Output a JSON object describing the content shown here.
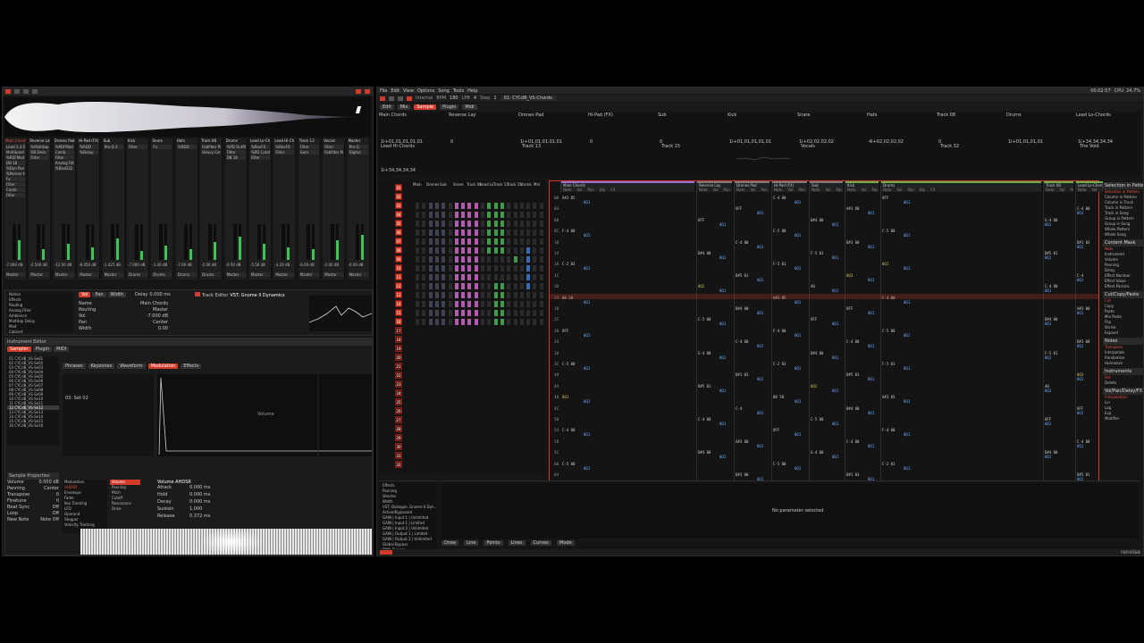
{
  "app": {
    "menu": [
      "File",
      "Edit",
      "View",
      "Options",
      "Song",
      "Tools",
      "Help"
    ],
    "transport": {
      "sync": "Internal",
      "bpm_label": "BPM",
      "bpm": "180",
      "lpb_label": "LPB",
      "lpb": "4",
      "pattern_label": "Ptn",
      "edit_step_label": "Step",
      "edit_step": "1",
      "instrument_select": "01: CYCdB_VS-Chords"
    },
    "status": {
      "cpu": "CPU: 24.7%",
      "time": "00:02:57",
      "brand": "renoise"
    },
    "right_tabs": [
      "Edit",
      "Mix",
      "Sample",
      "Plugin",
      "Midi"
    ],
    "colors": {
      "accent": "#d23a2a",
      "bg": "#161616",
      "note": "#cccccc",
      "volume": "#6ab0ff",
      "effect": "#d8c060",
      "meter": "#3ec35a"
    }
  },
  "automation": {
    "tracks": [
      "Main Chords",
      "Reverse Lay",
      "Drones Pad",
      "Hi-Pad (FX)",
      "Sub",
      "Kick",
      "Snare",
      "Hats",
      "Track 08",
      "Drums",
      "Lead Lo-Chords"
    ],
    "rows": [
      {
        "left": "1l+01,01,01,01,01",
        "right": "Lead Hi-Chords"
      },
      {
        "left": "1l+34,34,34,34",
        "right": ""
      }
    ],
    "cells_row1": [
      "0",
      "1l+01,01,01,01,01",
      "0",
      "0",
      "1l+01,01,01,01,01",
      "1l+02,02,02,02",
      "4l+02,02,02,02",
      "0",
      "1l+01,01,01,01",
      "1l+34,34,34,34"
    ],
    "cells_row1_sub": [
      "Track 13",
      "Track 15",
      "Vocals",
      "Track 32",
      "The Void"
    ]
  },
  "matrix": {
    "tracks": [
      "Main",
      "Drones",
      "Sub",
      "Snare",
      "Track 08",
      "Lead Lo",
      "Track 13",
      "Track 15",
      "Vocals",
      "Mst"
    ]
  },
  "pattern_editor": {
    "track_headers": [
      {
        "name": "Main Chords",
        "color": "#9b6fd8"
      },
      {
        "name": "Reverse Lay",
        "color": "#7a7a7a"
      },
      {
        "name": "Drones Pad",
        "color": "#7a7a7a"
      },
      {
        "name": "Hi-Pad (FX)",
        "color": "#7a7a7a"
      },
      {
        "name": "Sub",
        "color": "#7a7a7a"
      },
      {
        "name": "Kick",
        "color": "#6ab04a"
      },
      {
        "name": "Drums",
        "color": "#6ab04a"
      },
      {
        "name": "Track 08",
        "color": "#6ab04a"
      },
      {
        "name": "Lead Lo-Chords",
        "color": "#6ab04a"
      }
    ],
    "sub_columns": [
      "Note",
      "Vol",
      "Pan",
      "Dly",
      "FX"
    ],
    "row_numbers": [
      "00",
      "04",
      "08",
      "0C",
      "10",
      "14",
      "18",
      "1C",
      "20",
      "24",
      "28",
      "2C",
      "30",
      "34",
      "38",
      "3C",
      "40",
      "44",
      "48",
      "4C",
      "50",
      "54",
      "58",
      "5C",
      "60",
      "64",
      "68",
      "6C",
      "70",
      "74",
      "78",
      "7C"
    ],
    "notes": [
      "A#3 05",
      "C-4 00",
      "D#4 00",
      "C-4 00",
      "C-5 00",
      "OFF",
      "OFF",
      "OFF",
      "A#3 00",
      "F-4 00",
      "D#4 00",
      "C-4 00",
      "C-5 00",
      "G-4 00",
      "C-4 00",
      "C-5 00",
      "D#4 00",
      "D#3 00",
      "C-2 03",
      "F-5 01",
      "D#1 03",
      "F-5 01",
      "D#5 01",
      "D#5 01",
      "0Q1",
      "0Q2",
      "0Q3",
      "08 50",
      "40",
      "C-4"
    ]
  },
  "right_sidebar": {
    "sections": [
      {
        "title": "Selection in Pattern",
        "items": [
          "Selection in Pattern",
          "Column in Pattern",
          "Column in Track",
          "Track in Pattern",
          "Track in Song",
          "Group in Pattern",
          "Group in Song",
          "Whole Pattern",
          "Whole Song"
        ]
      },
      {
        "title": "Content Mask",
        "items": [
          "Note",
          "Instrument",
          "Volume",
          "Panning",
          "Delay",
          "Effect Number",
          "Effect Value",
          "Effect Params"
        ]
      },
      {
        "title": "Cut/Copy/Paste",
        "items": [
          "Cut",
          "Copy",
          "Paste",
          "Mix Paste",
          "Flip",
          "Shrink",
          "Expand"
        ]
      },
      {
        "title": "Notes",
        "items": [
          "Transpose",
          "Interpolate",
          "Randomize",
          "Humanize"
        ]
      },
      {
        "title": "Instruments",
        "items": [
          "Set",
          "Delete"
        ]
      },
      {
        "title": "Vol/Pan/Delay/FX",
        "items": [
          "Interpolation",
          "Lin",
          "Log",
          "Exp",
          "Modifier"
        ]
      }
    ]
  },
  "bottom_panel": {
    "tree_items": [
      "Effects",
      "Panning",
      "Volume",
      "Width",
      "VST: Dialogue, Gnome II Dyn...",
      "Active/Bypassed",
      "GAIN | Input 1 | Unlimited",
      "GAIN | Input 1 | Limited",
      "GAIN | Input 2 | Unlimited",
      "GAIN | Output 1 | Limited",
      "GAIN | Output 2 | Unlimited",
      "Global Bypass",
      "DYN: Bypass",
      "DYN: Sidechain"
    ],
    "no_param": "No parameter selected",
    "toolbar": [
      "Draw",
      "Line",
      "Points",
      "Lines",
      "Curves",
      "Mode"
    ]
  },
  "mixer": {
    "strips": [
      {
        "name": "Main Chords",
        "fx": [
          "Lead 1.3 Dy",
          "Multiband",
          "%PDFMod",
          "DB 18",
          "%Dyn Pan",
          "%Panner Hi",
          "Fx",
          "Filter",
          "Comb",
          "Filter"
        ],
        "db": "-7.000 dB",
        "out": "Master"
      },
      {
        "name": "Reverse Lay",
        "fx": [
          "%Multitap",
          "DB Deck",
          "Filter"
        ],
        "db": "-2.500 dB",
        "out": "Master"
      },
      {
        "name": "Drones Pad",
        "fx": [
          "%PDFMod",
          "Comb",
          "Filter",
          "Analog Filter",
          "%RevD32"
        ],
        "db": "-12.50 dB",
        "out": "Master"
      },
      {
        "name": "Hi-Pad (FX)",
        "fx": [
          "%RDD",
          "%Delay"
        ],
        "db": "-6.050 dB",
        "out": "Master"
      },
      {
        "name": "Sub",
        "fx": [
          "Pro-Q 3"
        ],
        "db": "-1.425 dB",
        "out": "Master"
      },
      {
        "name": "Kick",
        "fx": [
          "Filter"
        ],
        "db": "-7.000 dB",
        "out": "Drums"
      },
      {
        "name": "Snare",
        "fx": [
          "Fx"
        ],
        "db": "-1.00 dB",
        "out": "Drums"
      },
      {
        "name": "Hats",
        "fx": [
          "%RDD"
        ],
        "db": "-7.00 dB",
        "out": "Drums"
      },
      {
        "name": "Track 08",
        "fx": [
          "Fabfilter Pro",
          "Heavy Comp"
        ],
        "db": "-2.00 dB",
        "out": "Drums"
      },
      {
        "name": "Drums",
        "fx": [
          "%PD Outfits",
          "Filter",
          "DB 18"
        ],
        "db": "-0.50 dB",
        "out": "Master"
      },
      {
        "name": "Lead Lo-Ch",
        "fx": [
          "%RevFX",
          "%PD Cutoff",
          "Filter"
        ],
        "db": "-5.50 dB",
        "out": "Master"
      },
      {
        "name": "Lead Hi-Ch",
        "fx": [
          "%RevFX",
          "Filter"
        ],
        "db": "-3.20 dB",
        "out": "Master"
      },
      {
        "name": "Track 13",
        "fx": [
          "Filter",
          "Gain"
        ],
        "db": "-6.00 dB",
        "out": "Master"
      },
      {
        "name": "Vocals",
        "fx": [
          "Filter",
          "Fabfilter Pro"
        ],
        "db": "-2.00 dB",
        "out": "Master"
      },
      {
        "name": "Master",
        "fx": [
          "Pro-Q",
          "Digital"
        ],
        "db": "-0.00 dB",
        "out": "Master"
      }
    ]
  },
  "track_dsp": {
    "tree": [
      "Native",
      "Effects",
      "Routing",
      "Analog Filter",
      "Ambience",
      "Multitap Delay",
      "Mod",
      "Cabinet"
    ],
    "tabs": [
      "Vol",
      "Pan",
      "Width"
    ],
    "device_name": "VST: Gnome II Dynamics",
    "params": [
      {
        "label": "Name",
        "value": "Main Chords"
      },
      {
        "label": "Routing",
        "value": "Master"
      },
      {
        "label": "Vol",
        "value": "-7.000 dB"
      },
      {
        "label": "Pan",
        "value": "Center"
      },
      {
        "label": "Width",
        "value": "0.00"
      }
    ],
    "delay_label": "Delay",
    "delay_value": "0.000 ms",
    "bus_label": "Track Editor"
  },
  "instrument": {
    "title": "Instrument Editor",
    "tabs": [
      "Sampler",
      "Plugin",
      "MIDI"
    ],
    "sub_tabs": [
      "Phrases",
      "Keyzones",
      "Waveform",
      "Modulation",
      "Effects"
    ],
    "samples": [
      "01 CYCdB_VS-Se01",
      "02 CYCdB_VS-Se02",
      "03 CYCdB_VS-Se03",
      "04 CYCdB_VS-Se04",
      "05 CYCdB_VS-Se05",
      "06 CYCdB_VS-Se06",
      "07 CYCdB_VS-Se07",
      "08 CYCdB_VS-Se08",
      "09 CYCdB_VS-Se09",
      "10 CYCdB_VS-Se10",
      "11 CYCdB_VS-Se11",
      "12 CYCdB_VS-Se12",
      "13 CYCdB_VS-Se13",
      "14 CYCdB_VS-Se14",
      "15 CYCdB_VS-Se15",
      "16 CYCdB_VS-Se16"
    ],
    "mod_set": "03: Set 02",
    "volume_label": "Volume",
    "sample_props_title": "Sample Properties",
    "sample_props": [
      {
        "label": "Volume",
        "value": "0.000 dB"
      },
      {
        "label": "Panning",
        "value": "Center"
      },
      {
        "label": "Transpose",
        "value": "0"
      },
      {
        "label": "Finetune",
        "value": "0"
      },
      {
        "label": "Beat Sync",
        "value": "Off"
      },
      {
        "label": "Loop",
        "value": "Off"
      },
      {
        "label": "New Note",
        "value": "Note Off"
      }
    ],
    "mod_tree": [
      "Modulation",
      "AHDSR",
      "Envelope",
      "Fader",
      "Key Tracking",
      "LFO",
      "Operand",
      "Stepper",
      "Velocity Tracking"
    ],
    "mod_targets": [
      "Volume",
      "Panning",
      "Pitch",
      "Cutoff",
      "Resonance",
      "Drive"
    ],
    "ahdsr_title": "Volume AHDSR",
    "ahdsr": [
      {
        "label": "Attack",
        "value": "0.000 ms"
      },
      {
        "label": "Hold",
        "value": "0.000 ms"
      },
      {
        "label": "Decay",
        "value": "0.000 ms"
      },
      {
        "label": "Sustain",
        "value": "1.000"
      },
      {
        "label": "Release",
        "value": "0.372 ms"
      }
    ]
  }
}
